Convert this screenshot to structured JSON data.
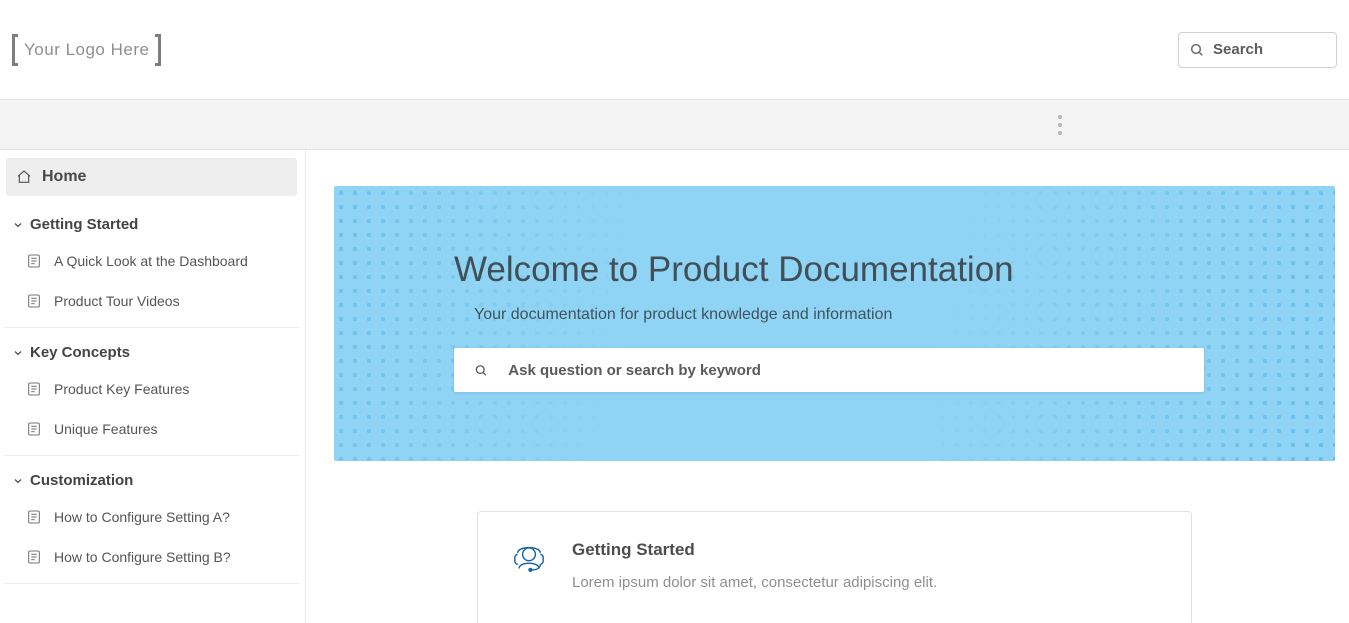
{
  "header": {
    "logo_text": "Your Logo Here",
    "search_placeholder": "Search"
  },
  "sidebar": {
    "home_label": "Home",
    "sections": [
      {
        "title": "Getting Started",
        "items": [
          {
            "label": "A Quick Look at the Dashboard"
          },
          {
            "label": "Product Tour Videos"
          }
        ]
      },
      {
        "title": "Key Concepts",
        "items": [
          {
            "label": "Product Key Features"
          },
          {
            "label": "Unique Features"
          }
        ]
      },
      {
        "title": "Customization",
        "items": [
          {
            "label": "How to Configure Setting A?"
          },
          {
            "label": "How to Configure Setting B?"
          }
        ]
      }
    ]
  },
  "hero": {
    "title": "Welcome to Product Documentation",
    "subtitle": "Your documentation for product knowledge and information",
    "search_placeholder": "Ask question or search by keyword"
  },
  "card": {
    "title": "Getting Started",
    "description": "Lorem ipsum dolor sit amet, consectetur adipiscing elit."
  }
}
